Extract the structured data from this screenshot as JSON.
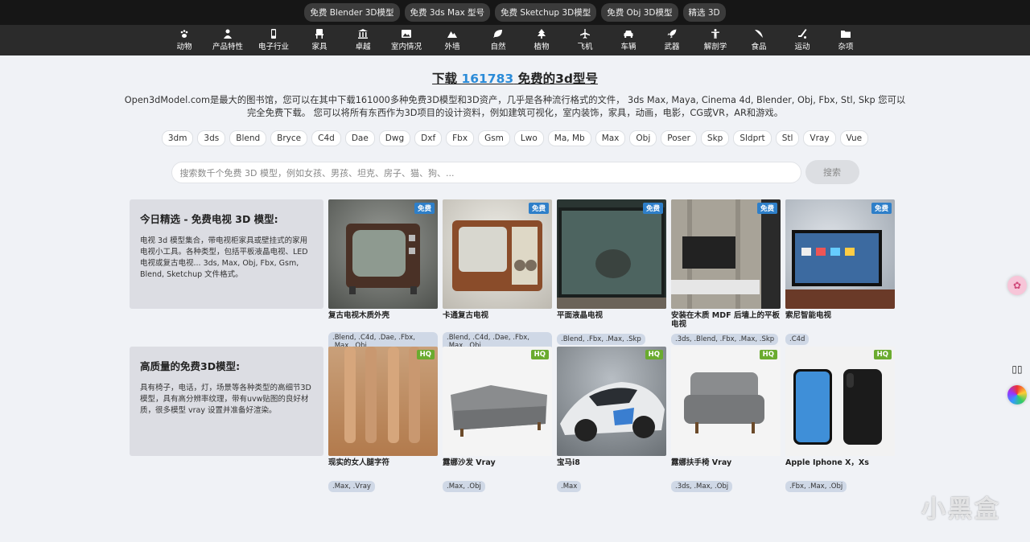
{
  "topbar": [
    "免费 Blender 3D模型",
    "免费 3ds Max 型号",
    "免费 Sketchup 3D模型",
    "免费 Obj 3D模型",
    "精选 3D"
  ],
  "categories": [
    {
      "label": "动物",
      "icon": "paw-icon"
    },
    {
      "label": "产品特性",
      "icon": "person-icon"
    },
    {
      "label": "电子行业",
      "icon": "phone-icon"
    },
    {
      "label": "家具",
      "icon": "chair-icon"
    },
    {
      "label": "卓越",
      "icon": "bank-icon"
    },
    {
      "label": "室内情况",
      "icon": "image-icon"
    },
    {
      "label": "外墙",
      "icon": "mountain-icon"
    },
    {
      "label": "自然",
      "icon": "leaf-icon"
    },
    {
      "label": "植物",
      "icon": "tree-icon"
    },
    {
      "label": "飞机",
      "icon": "plane-icon"
    },
    {
      "label": "车辆",
      "icon": "car-icon"
    },
    {
      "label": "武器",
      "icon": "rocket-icon"
    },
    {
      "label": "解剖学",
      "icon": "body-icon"
    },
    {
      "label": "食品",
      "icon": "pizza-icon"
    },
    {
      "label": "运动",
      "icon": "hockey-icon"
    },
    {
      "label": "杂项",
      "icon": "folder-icon"
    }
  ],
  "headline": {
    "prefix": "下载 ",
    "count": "161783",
    "suffix": " 免费的3d型号"
  },
  "description": "Open3dModel.com是最大的图书馆，您可以在其中下载161000多种免费3D模型和3D资产，几乎是各种流行格式的文件， 3ds Max, Maya, Cinema 4d, Blender, Obj, Fbx, Stl, Skp 您可以完全免费下载。 您可以将所有东西作为3D项目的设计资料，例如建筑可视化，室内装饰，家具，动画，电影，CG或VR，AR和游戏。",
  "formats": [
    "3dm",
    "3ds",
    "Blend",
    "Bryce",
    "C4d",
    "Dae",
    "Dwg",
    "Dxf",
    "Fbx",
    "Gsm",
    "Lwo",
    "Ma, Mb",
    "Max",
    "Obj",
    "Poser",
    "Skp",
    "Sldprt",
    "Stl",
    "Vray",
    "Vue"
  ],
  "search": {
    "placeholder": "搜索数千个免费 3D 模型，例如女孩、男孩、坦克、房子、猫、狗、...",
    "button": "搜索"
  },
  "sections": [
    {
      "title": "今日精选 - 免费电视 3D 模型:",
      "text": "电视 3d 模型集合，带电视柜家具或壁挂式的家用电视小工具。各种类型，包括平板液晶电视、LED电视或复古电视... 3ds, Max, Obj, Fbx, Gsm, Blend, Sketchup 文件格式。",
      "cards": [
        {
          "title": "复古电视木质外壳",
          "badge": "免费",
          "tags": ".Blend, .C4d, .Dae, .Fbx, .Max, .Obj",
          "bg": "#6b6e6a"
        },
        {
          "title": "卡通复古电视",
          "badge": "免费",
          "tags": ".Blend, .C4d, .Dae, .Fbx, .Max, .Obj",
          "bg": "#8a6a52"
        },
        {
          "title": "平面液晶电视",
          "badge": "免费",
          "tags": ".Blend, .Fbx, .Max, .Skp",
          "bg": "#3e4f4c"
        },
        {
          "title": "安装在木质 MDF 后墙上的平板电视",
          "badge": "免费",
          "tags": ".3ds, .Blend, .Fbx, .Max, .Skp",
          "bg": "#9a9892"
        },
        {
          "title": "索尼智能电视",
          "badge": "免费",
          "tags": ".C4d",
          "bg": "#5a6c84"
        }
      ]
    },
    {
      "title": "高质量的免费3D模型:",
      "text": "具有椅子，电话，灯，场景等各种类型的高细节3D模型，具有高分辨率纹理，带有uvw贴图的良好材质，很多模型 vray 设置并准备好渲染。",
      "cards": [
        {
          "title": "现实的女人腿字符",
          "badge": "HQ",
          "tags": ".Max, .Vray",
          "bg": "#c0905e"
        },
        {
          "title": "露娜沙发 Vray",
          "badge": "HQ",
          "tags": ".Max, .Obj",
          "bg": "#f2f2f2"
        },
        {
          "title": "宝马i8",
          "badge": "HQ",
          "tags": ".Max",
          "bg": "#8d9398"
        },
        {
          "title": "露娜扶手椅 Vray",
          "badge": "HQ",
          "tags": ".3ds, .Max, .Obj",
          "bg": "#f2f2f2"
        },
        {
          "title": "Apple Iphone X，Xs",
          "badge": "HQ",
          "tags": ".Fbx, .Max, .Obj",
          "bg": "#eeeeee"
        }
      ]
    }
  ],
  "watermark": "小黑盒"
}
